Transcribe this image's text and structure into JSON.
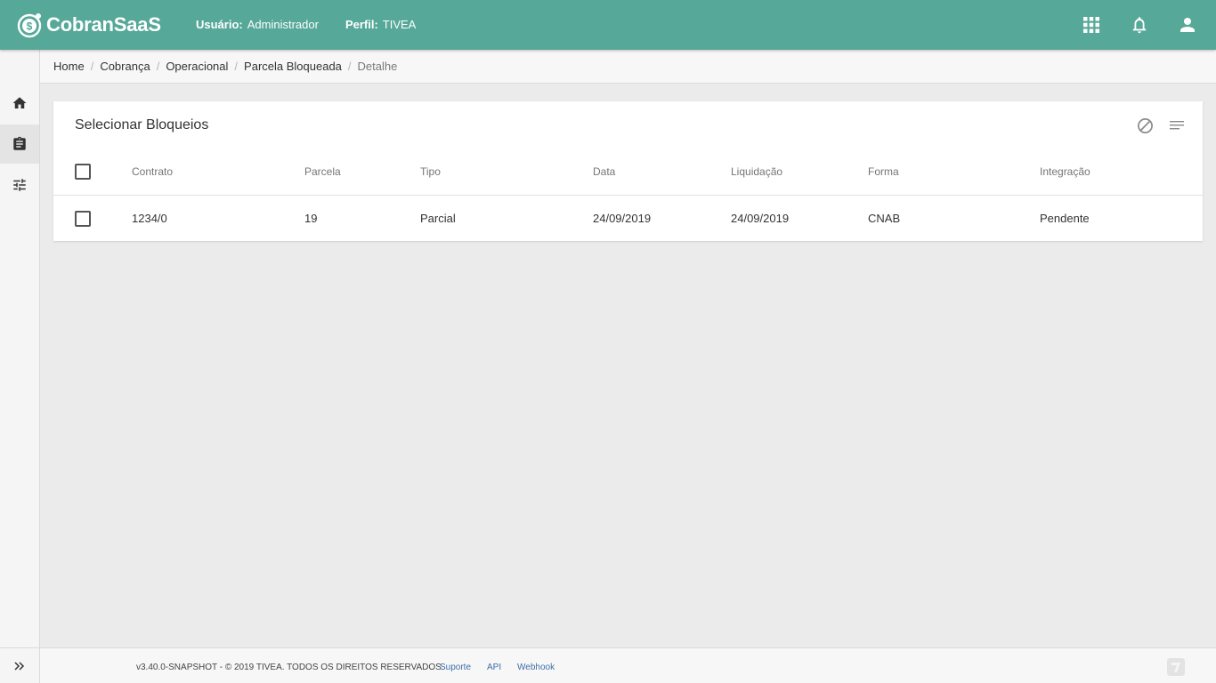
{
  "app": {
    "brand": "CobranSaaS"
  },
  "header": {
    "user_label": "Usuário:",
    "user_value": "Administrador",
    "profile_label": "Perfil:",
    "profile_value": "TIVEA",
    "icons": [
      "apps-grid-icon",
      "notifications-bell-icon",
      "account-icon"
    ]
  },
  "sidebar": {
    "items": [
      {
        "icon": "home-icon"
      },
      {
        "icon": "clipboard-icon",
        "active": true
      },
      {
        "icon": "settings-sliders-icon"
      }
    ],
    "expand_icon": "double-chevron-right-icon"
  },
  "breadcrumb": [
    "Home",
    "Cobrança",
    "Operacional",
    "Parcela Bloqueada",
    "Detalhe"
  ],
  "card": {
    "title": "Selecionar Bloqueios",
    "actions": [
      "block-icon",
      "filter-list-icon"
    ]
  },
  "table": {
    "columns": [
      "Contrato",
      "Parcela",
      "Tipo",
      "Data",
      "Liquidação",
      "Forma",
      "Integração"
    ],
    "rows": [
      [
        "1234/0",
        "19",
        "Parcial",
        "24/09/2019",
        "24/09/2019",
        "CNAB",
        "Pendente"
      ]
    ]
  },
  "footer": {
    "copyright": "v3.40.0-SNAPSHOT - © 2019 TIVEA. TODOS OS DIREITOS RESERVADOS.",
    "links": [
      "Suporte",
      "API",
      "Webhook"
    ]
  },
  "colors": {
    "topbar": "#56a899",
    "link": "#3d6fa8",
    "background": "#ebebeb"
  }
}
